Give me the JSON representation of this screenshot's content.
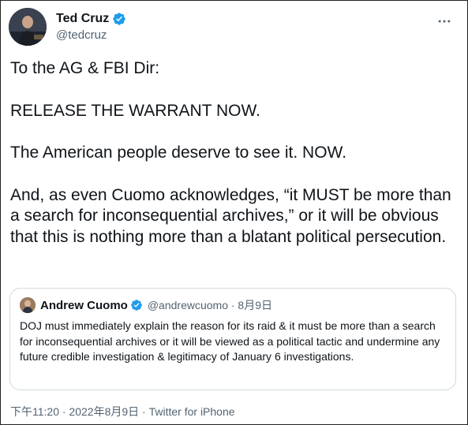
{
  "author": {
    "display_name": "Ted Cruz",
    "handle": "@tedcruz"
  },
  "tweet": {
    "paragraphs": [
      "To the AG & FBI Dir:",
      "RELEASE THE WARRANT NOW.",
      "The American people deserve to see it. NOW.",
      "And, as even Cuomo acknowledges, “it MUST be more than a search for inconsequential archives,” or it will be obvious that this is nothing more than a blatant political persecution."
    ]
  },
  "quote": {
    "display_name": "Andrew Cuomo",
    "handle_date": "@andrewcuomo · 8月9日",
    "text": "DOJ must immediately explain the reason for its raid & it must be more than a search for inconsequential archives or it will be viewed as a political tactic and undermine any future credible investigation & legitimacy of January 6 investigations."
  },
  "meta": {
    "timestamp": "下午11:20 · 2022年8月9日 · Twitter for iPhone"
  },
  "icons": {
    "verified": "verified-badge-icon",
    "more": "more-options-icon"
  },
  "colors": {
    "verified": "#1d9bf0",
    "text": "#0f1419",
    "secondary": "#536471",
    "border": "#cfd9de"
  }
}
